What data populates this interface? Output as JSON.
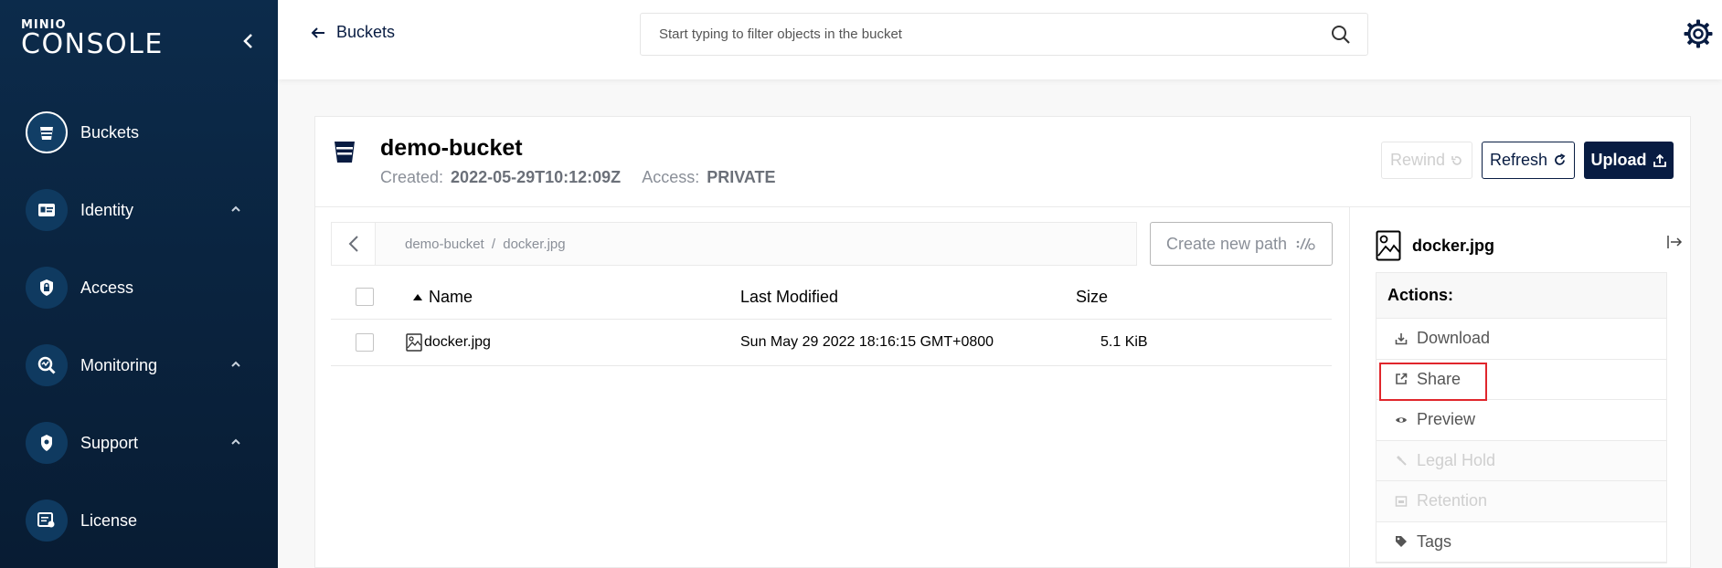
{
  "sidebar": {
    "logo_brand": "MINIO",
    "logo_product": "CONSOLE",
    "items": [
      {
        "label": "Buckets"
      },
      {
        "label": "Identity"
      },
      {
        "label": "Access"
      },
      {
        "label": "Monitoring"
      },
      {
        "label": "Support"
      },
      {
        "label": "License"
      }
    ]
  },
  "topbar": {
    "back_label": "Buckets",
    "search_placeholder": "Start typing to filter objects in the bucket"
  },
  "bucket": {
    "name": "demo-bucket",
    "created_label": "Created:",
    "created_value": "2022-05-29T10:12:09Z",
    "access_label": "Access:",
    "access_value": "PRIVATE",
    "buttons": {
      "rewind": "Rewind",
      "refresh": "Refresh",
      "upload": "Upload"
    }
  },
  "browser": {
    "breadcrumb": {
      "bucket": "demo-bucket",
      "separator": "/",
      "object": "docker.jpg"
    },
    "create_path_label": "Create new path",
    "columns": {
      "name": "Name",
      "modified": "Last Modified",
      "size": "Size"
    },
    "rows": [
      {
        "name": "docker.jpg",
        "modified": "Sun May 29 2022 18:16:15 GMT+0800",
        "size": "5.1 KiB"
      }
    ]
  },
  "details": {
    "filename": "docker.jpg",
    "actions_title": "Actions:",
    "actions": [
      "Download",
      "Share",
      "Preview",
      "Legal Hold",
      "Retention",
      "Tags"
    ]
  },
  "colors": {
    "sidebar": "#0c2b4b",
    "primary": "#081c42",
    "highlight": "#e0262c"
  }
}
